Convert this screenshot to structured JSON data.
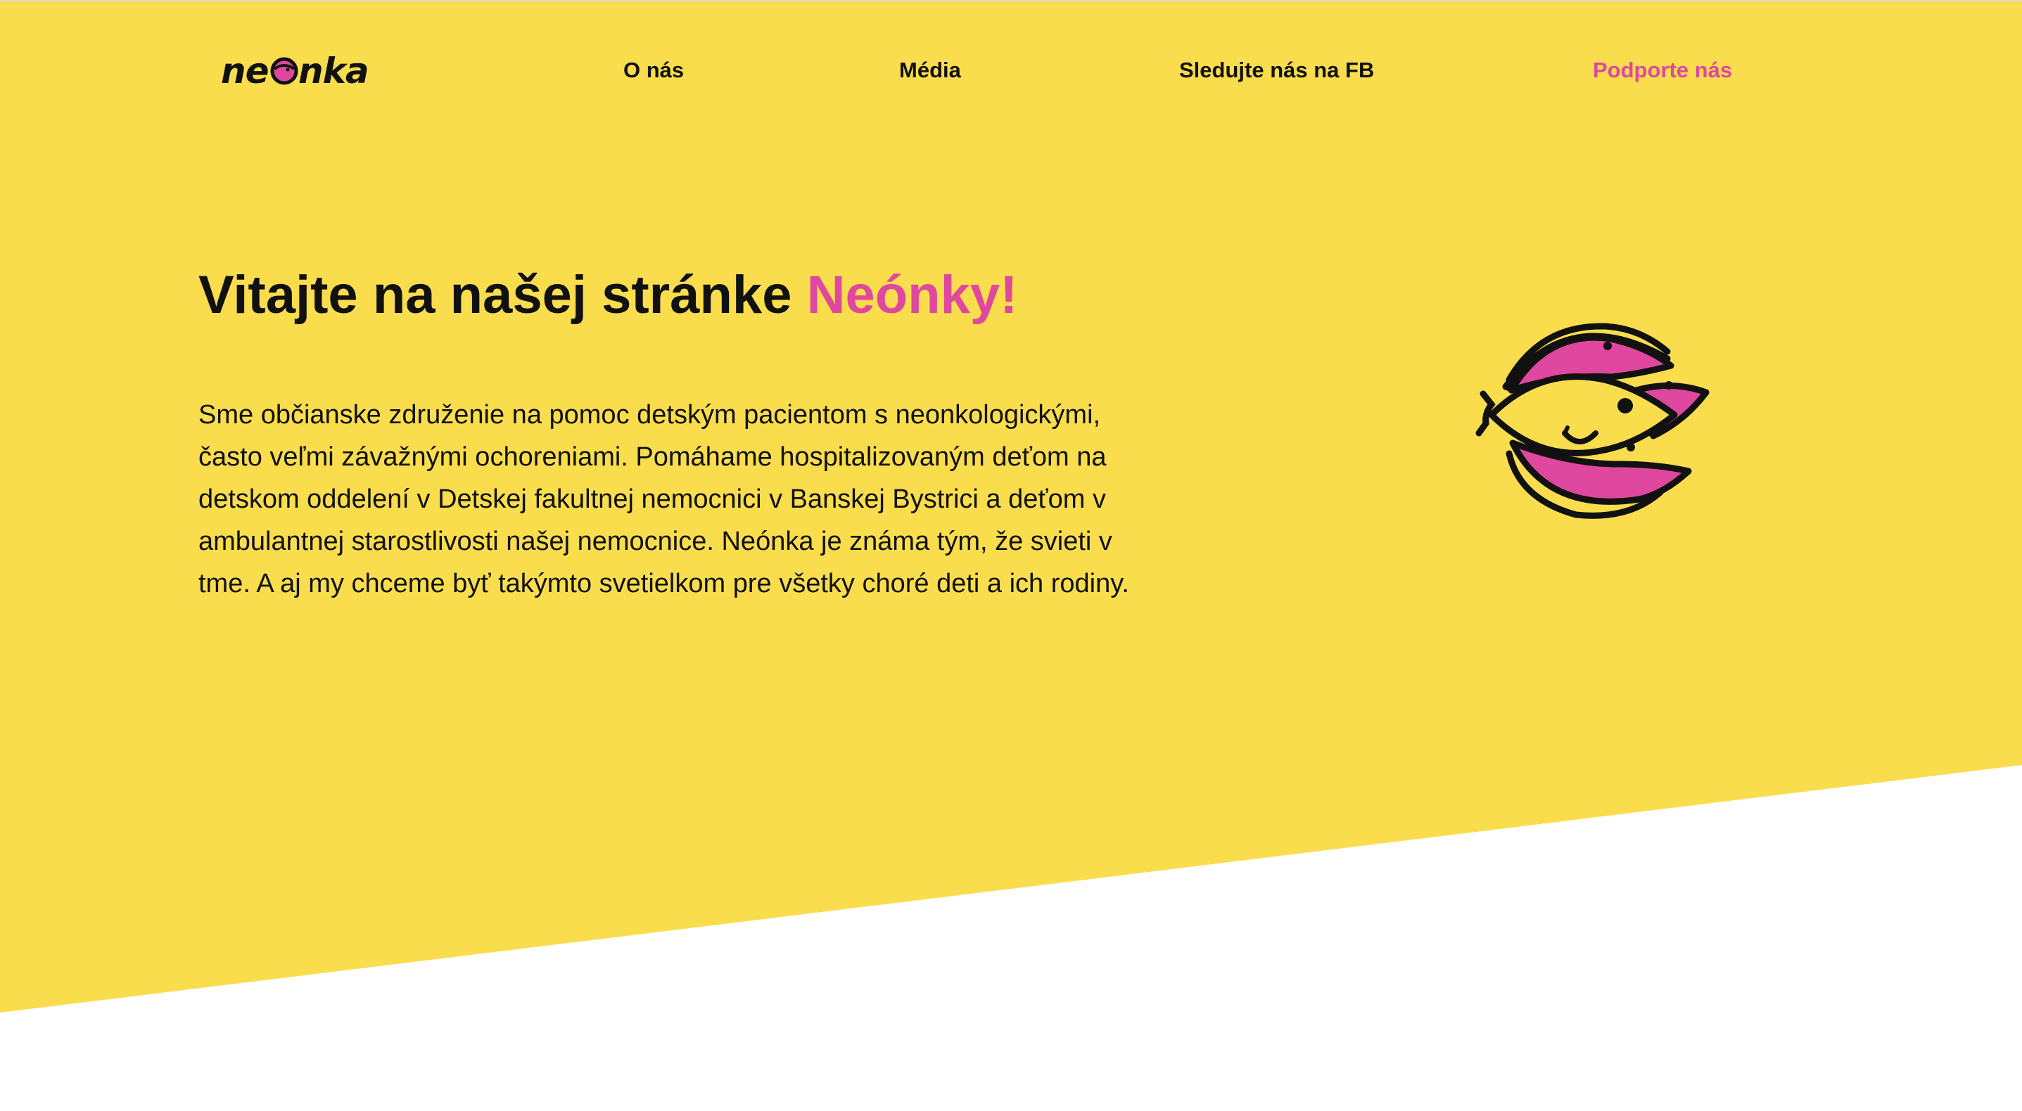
{
  "brand": {
    "logo_text": "neonka",
    "colors": {
      "yellow": "#f9dd4d",
      "pink": "#e0479e",
      "text": "#111111"
    }
  },
  "nav": {
    "items": [
      {
        "id": "about",
        "label": "O nás"
      },
      {
        "id": "media",
        "label": "Média"
      },
      {
        "id": "facebook",
        "label": "Sledujte nás na FB"
      },
      {
        "id": "support",
        "label": "Podporte nás"
      }
    ]
  },
  "hero": {
    "title_main": "Vitajte na našej stránke ",
    "title_accent": "Neónky!",
    "paragraph": "Sme občianske združenie na pomoc detským pacientom s neonkologickými, často veľmi závažnými ochoreniami. Pomáhame hospitalizovaným deťom na detskom oddelení v Detskej fakultnej nemocnici v Banskej Bystrici a deťom v ambulantnej starostlivosti našej nemocnice. Neónka je známa tým, že svieti v tme. A aj my chceme byť takýmto svetielkom pre všetky choré deti a ich rodiny.",
    "mascot_icon": "fish-mascot-icon"
  }
}
